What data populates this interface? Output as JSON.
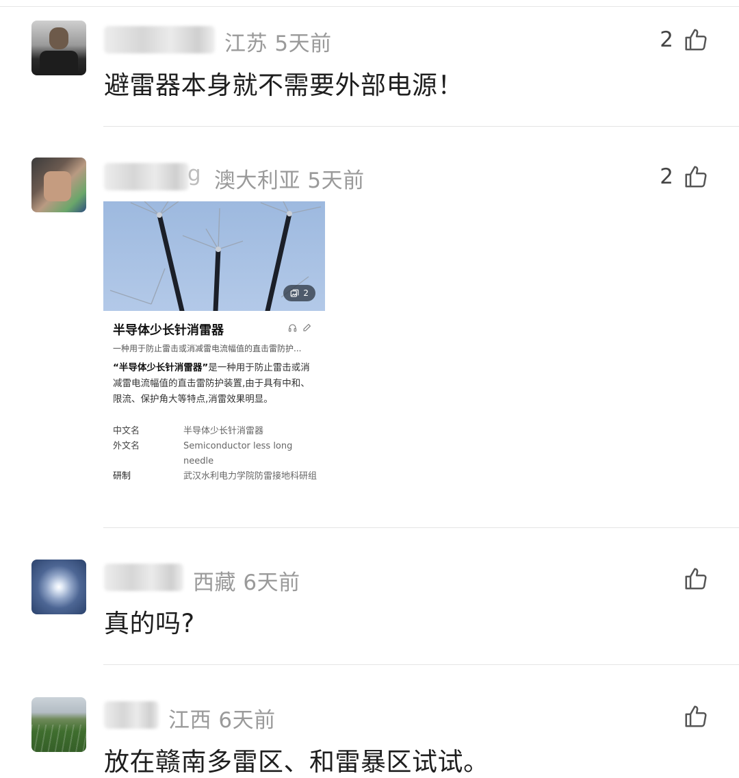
{
  "comments": [
    {
      "location": "江苏",
      "time": "5天前",
      "text": "避雷器本身就不需要外部电源！",
      "likes": "2"
    },
    {
      "location": "澳大利亚",
      "time": "5天前",
      "likes": "2",
      "name_tail": "g",
      "card": {
        "image_count": "2",
        "title": "半导体少长针消雷器",
        "subtitle": "一种用于防止雷击或消减雷电流幅值的直击雷防护...",
        "desc_bold": "“半导体少长针消雷器”",
        "desc_rest": "是一种用于防止雷击或消减雷电流幅值的直击雷防护装置,由于具有中和、限流、保护角大等特点,消雷效果明显。",
        "info": [
          {
            "label": "中文名",
            "value": "半导体少长针消雷器"
          },
          {
            "label": "外文名",
            "value": "Semiconductor less long needle"
          },
          {
            "label": "研制",
            "value": "武汉水利电力学院防雷接地科研组"
          }
        ]
      }
    },
    {
      "location": "西藏",
      "time": "6天前",
      "text": "真的吗?",
      "likes": ""
    },
    {
      "location": "江西",
      "time": "6天前",
      "text": "放在赣南多雷区、和雷暴区试试。",
      "likes": ""
    }
  ],
  "icons": {
    "like": "thumbs-up-icon",
    "gallery": "gallery-icon",
    "audio": "headphones-icon",
    "edit": "pencil-icon"
  }
}
